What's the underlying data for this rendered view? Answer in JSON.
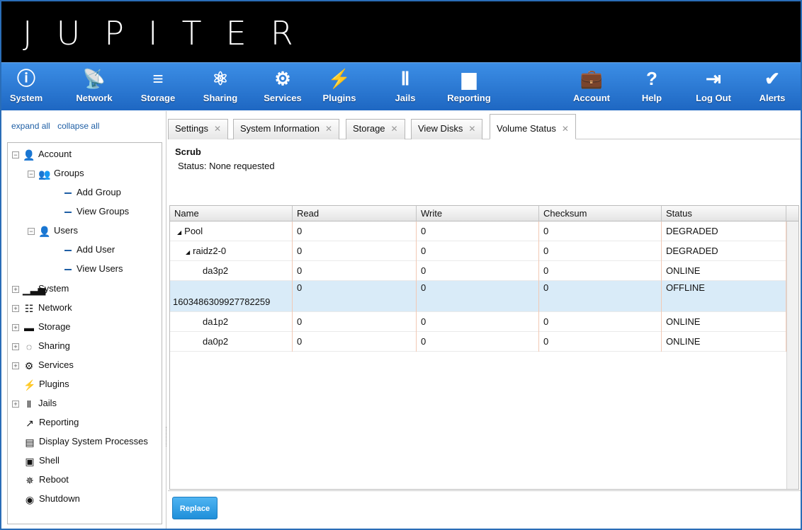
{
  "brand": {
    "title": "JUPITER"
  },
  "colors": {
    "nav_top": "#3c8ee6",
    "nav_bottom": "#1e67c2",
    "accent": "#1f5fa5",
    "selected_row": "#d9ebf8"
  },
  "topnav": {
    "items": [
      {
        "label": "System",
        "icon": "system-icon",
        "glyph": "ⓘ"
      },
      {
        "label": "Network",
        "icon": "satellite-icon",
        "glyph": "📡"
      },
      {
        "label": "Storage",
        "icon": "storage-icon",
        "glyph": "≡"
      },
      {
        "label": "Sharing",
        "icon": "sharing-icon",
        "glyph": "⚛"
      },
      {
        "label": "Services",
        "icon": "gears-icon",
        "glyph": "⚙"
      },
      {
        "label": "Plugins",
        "icon": "lightning-icon",
        "glyph": "⚡"
      },
      {
        "label": "Jails",
        "icon": "jails-icon",
        "glyph": "Ⅱ"
      },
      {
        "label": "Reporting",
        "icon": "bar-chart-icon",
        "glyph": "▆"
      },
      {
        "label": "Account",
        "icon": "briefcase-icon",
        "glyph": "💼"
      },
      {
        "label": "Help",
        "icon": "help-icon",
        "glyph": "?"
      },
      {
        "label": "Log Out",
        "icon": "logout-icon",
        "glyph": "⇥"
      },
      {
        "label": "Alerts",
        "icon": "check-icon",
        "glyph": "✔"
      }
    ]
  },
  "sidebar": {
    "expand_all": "expand all",
    "collapse_all": "collapse all",
    "tree": [
      {
        "label": "Account",
        "icon": "user-icon",
        "glyph": "👤",
        "toggle": "−",
        "level": 0
      },
      {
        "label": "Groups",
        "icon": "groups-icon",
        "glyph": "👥",
        "toggle": "−",
        "level": 1
      },
      {
        "label": "Add Group",
        "icon": "dash-icon",
        "level": 2
      },
      {
        "label": "View Groups",
        "icon": "dash-icon",
        "level": 2
      },
      {
        "label": "Users",
        "icon": "users-icon",
        "glyph": "👤",
        "toggle": "−",
        "level": 1
      },
      {
        "label": "Add User",
        "icon": "dash-icon",
        "level": 2
      },
      {
        "label": "View Users",
        "icon": "dash-icon",
        "level": 2
      },
      {
        "label": "System",
        "icon": "system-chart-icon",
        "glyph": "▁▃▅",
        "toggle": "+",
        "level": 0
      },
      {
        "label": "Network",
        "icon": "network-icon",
        "glyph": "☷",
        "toggle": "+",
        "level": 0
      },
      {
        "label": "Storage",
        "icon": "folder-icon",
        "glyph": "▬",
        "toggle": "+",
        "level": 0
      },
      {
        "label": "Sharing",
        "icon": "sharing-icon",
        "glyph": "◌",
        "toggle": "+",
        "level": 0
      },
      {
        "label": "Services",
        "icon": "gears-icon",
        "glyph": "⚙",
        "toggle": "+",
        "level": 0
      },
      {
        "label": "Plugins",
        "icon": "lightning-icon",
        "glyph": "⚡",
        "level": 0
      },
      {
        "label": "Jails",
        "icon": "jails-icon",
        "glyph": "Ⅱ",
        "toggle": "+",
        "level": 0
      },
      {
        "label": "Reporting",
        "icon": "reporting-icon",
        "glyph": "↗",
        "level": 0
      },
      {
        "label": "Display System Processes",
        "icon": "processes-icon",
        "glyph": "▤",
        "level": 0
      },
      {
        "label": "Shell",
        "icon": "shell-icon",
        "glyph": "▣",
        "level": 0
      },
      {
        "label": "Reboot",
        "icon": "reboot-icon",
        "glyph": "✵",
        "level": 0
      },
      {
        "label": "Shutdown",
        "icon": "shutdown-icon",
        "glyph": "◉",
        "level": 0
      }
    ]
  },
  "tabs": [
    {
      "label": "Settings",
      "close": "✕"
    },
    {
      "label": "System Information",
      "close": "✕"
    },
    {
      "label": "Storage",
      "close": "✕"
    },
    {
      "label": "View Disks",
      "close": "✕"
    },
    {
      "label": "Volume Status",
      "close": "✕",
      "active": true
    }
  ],
  "scrub": {
    "title": "Scrub",
    "status": "Status: None requested"
  },
  "table": {
    "columns": [
      "Name",
      "Read",
      "Write",
      "Checksum",
      "Status"
    ],
    "rows": [
      {
        "name": "Pool",
        "expander": "◢",
        "indent": 0,
        "read": "0",
        "write": "0",
        "checksum": "0",
        "status": "DEGRADED"
      },
      {
        "name": "raidz2-0",
        "expander": "◢",
        "indent": 1,
        "read": "0",
        "write": "0",
        "checksum": "0",
        "status": "DEGRADED"
      },
      {
        "name": "da3p2",
        "indent": 2,
        "read": "0",
        "write": "0",
        "checksum": "0",
        "status": "ONLINE"
      },
      {
        "name": "1603486309927782259",
        "indent": 3,
        "read": "0",
        "write": "0",
        "checksum": "0",
        "status": "OFFLINE",
        "selected": true
      },
      {
        "name": "da1p2",
        "indent": 2,
        "read": "0",
        "write": "0",
        "checksum": "0",
        "status": "ONLINE"
      },
      {
        "name": "da0p2",
        "indent": 2,
        "read": "0",
        "write": "0",
        "checksum": "0",
        "status": "ONLINE"
      }
    ]
  },
  "footer": {
    "replace_label": "Replace"
  }
}
